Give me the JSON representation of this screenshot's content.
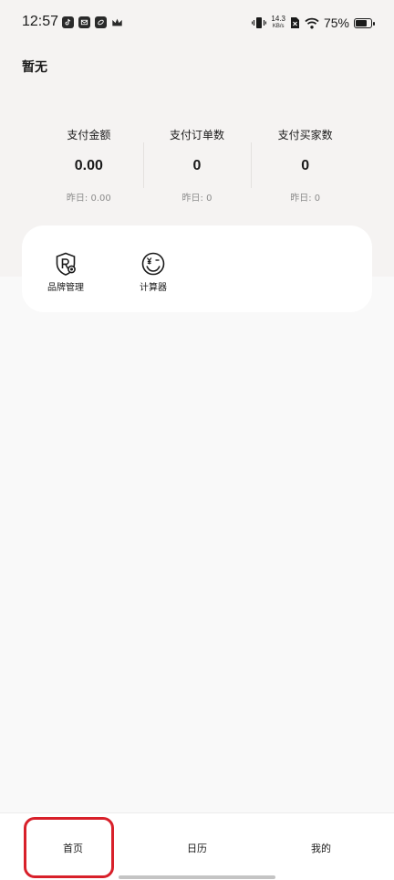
{
  "status_bar": {
    "time": "12:57",
    "app_icons": [
      "tiktok-icon",
      "mail-icon",
      "app-icon",
      "crown-icon"
    ],
    "net_speed_value": "14.3",
    "net_speed_unit": "KB/s",
    "battery_percent": "75%",
    "battery_level": 0.75
  },
  "header": {
    "shop_name": "暂无"
  },
  "stats": [
    {
      "label": "支付金额",
      "value": "0.00",
      "yesterday": "昨日: 0.00"
    },
    {
      "label": "支付订单数",
      "value": "0",
      "yesterday": "昨日: 0"
    },
    {
      "label": "支付买家数",
      "value": "0",
      "yesterday": "昨日: 0"
    }
  ],
  "tools": [
    {
      "label": "品牌管理",
      "icon": "brand-shield-icon"
    },
    {
      "label": "计算器",
      "icon": "calculator-smile-icon"
    }
  ],
  "bottom_nav": {
    "items": [
      {
        "label": "首页"
      },
      {
        "label": "日历"
      },
      {
        "label": "我的"
      }
    ],
    "highlight_color": "#d8202a"
  }
}
